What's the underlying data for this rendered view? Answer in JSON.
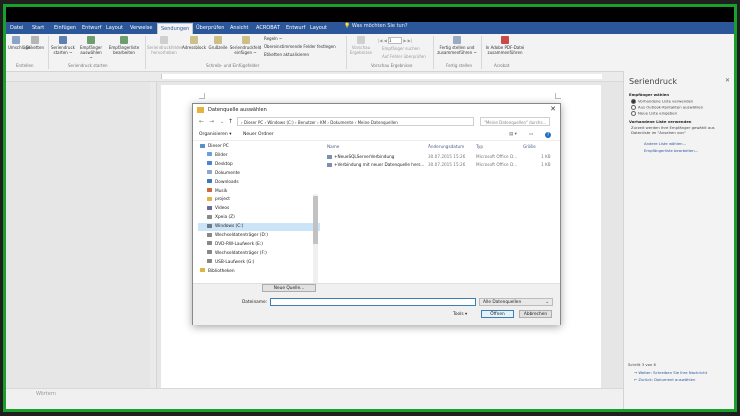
{
  "tabs": [
    "Datei",
    "Start",
    "Einfügen",
    "Entwurf",
    "Layout",
    "Verweise",
    "Sendungen",
    "Überprüfen",
    "Ansicht",
    "ACROBAT",
    "Entwurf",
    "Layout"
  ],
  "active_tab_index": 6,
  "tell_me": "Was möchten Sie tun?",
  "ribbon": {
    "buttons": [
      "Umschläge",
      "Etiketten",
      "Seriendruck starten ~",
      "Empfänger auswählen ~",
      "Empfängerliste bearbeiten",
      "Seriendruckfelder hervorheben",
      "Adressblock",
      "Grußzeile",
      "Seriendruckfeld einfügen ~",
      "Regeln ~",
      "Übereinstimmende Felder festlegen",
      "Etiketten aktualisieren",
      "Vorschau Ergebnisse",
      "Empfänger suchen",
      "Auf Fehler überprüfen",
      "Fertig stellen und zusammenführen ~",
      "In Adobe PDF-Datei zusammenführen"
    ],
    "groups": [
      "Erstellen",
      "Seriendruck starten",
      "Schreib- und Einfügefelder",
      "Vorschau Ergebnisse",
      "Fertig stellen",
      "Acrobat"
    ],
    "record_number": "1"
  },
  "status_text": "Wörtern",
  "pane": {
    "title": "Seriendruck",
    "section1": "Empfänger wählen",
    "options": [
      "Vorhandene Liste verwenden",
      "Aus Outlook-Kontakten auswählen",
      "Neue Liste eingeben"
    ],
    "section2": "Vorhandene Liste verwenden",
    "description": "Zurzeit werden Ihre Empfänger gewählt aus Datenliste im \"Ansehen von\"",
    "link1": "Andere Liste wählen...",
    "link2": "Empfängerliste bearbeiten...",
    "step": "Schritt 3 von 6",
    "next": "Weiter: Schreiben Sie Ihre Nachricht",
    "prev": "Zurück: Dokument auswählen"
  },
  "dialog": {
    "title": "Datenquelle auswählen",
    "breadcrumb": "› Dieser PC  ›  Windows (C:)  ›  Benutzer  ›  KM  ›  Dokumente  ›  Meine Datenquellen",
    "search_placeholder": "\"Meine Datenquellen\" durchs...",
    "organize": "Organisieren ▾",
    "new_folder": "Neuer Ordner",
    "nav_items": [
      "Dieser PC",
      "Bilder",
      "Desktop",
      "Dokumente",
      "Downloads",
      "Musik",
      "project",
      "Videos",
      "Xpeia (Z)",
      "Windows (C:)",
      "Wechseldatenträger (D:)",
      "DVD-RW-Laufwerk (E:)",
      "Wechseldatenträger (F:)",
      "USB-Laufwerk (G:)",
      "Bibliotheken"
    ],
    "selected_nav_index": 9,
    "columns": [
      "Name",
      "Änderungsdatum",
      "Typ",
      "Größe"
    ],
    "files": [
      {
        "name": "+NeueSQLServerVerbindung",
        "date": "30.07.2015 15:26",
        "type": "Microsoft Office D...",
        "size": "1 KB"
      },
      {
        "name": "+Verbindung mit neuer Datenquelle hers...",
        "date": "30.07.2015 15:26",
        "type": "Microsoft Office D...",
        "size": "1 KB"
      }
    ],
    "new_source": "Neue Quelle...",
    "filename_label": "Dateiname:",
    "filetype": "Alle Datenquellen",
    "tools": "Tools",
    "open": "Öffnen",
    "cancel": "Abbrechen"
  }
}
